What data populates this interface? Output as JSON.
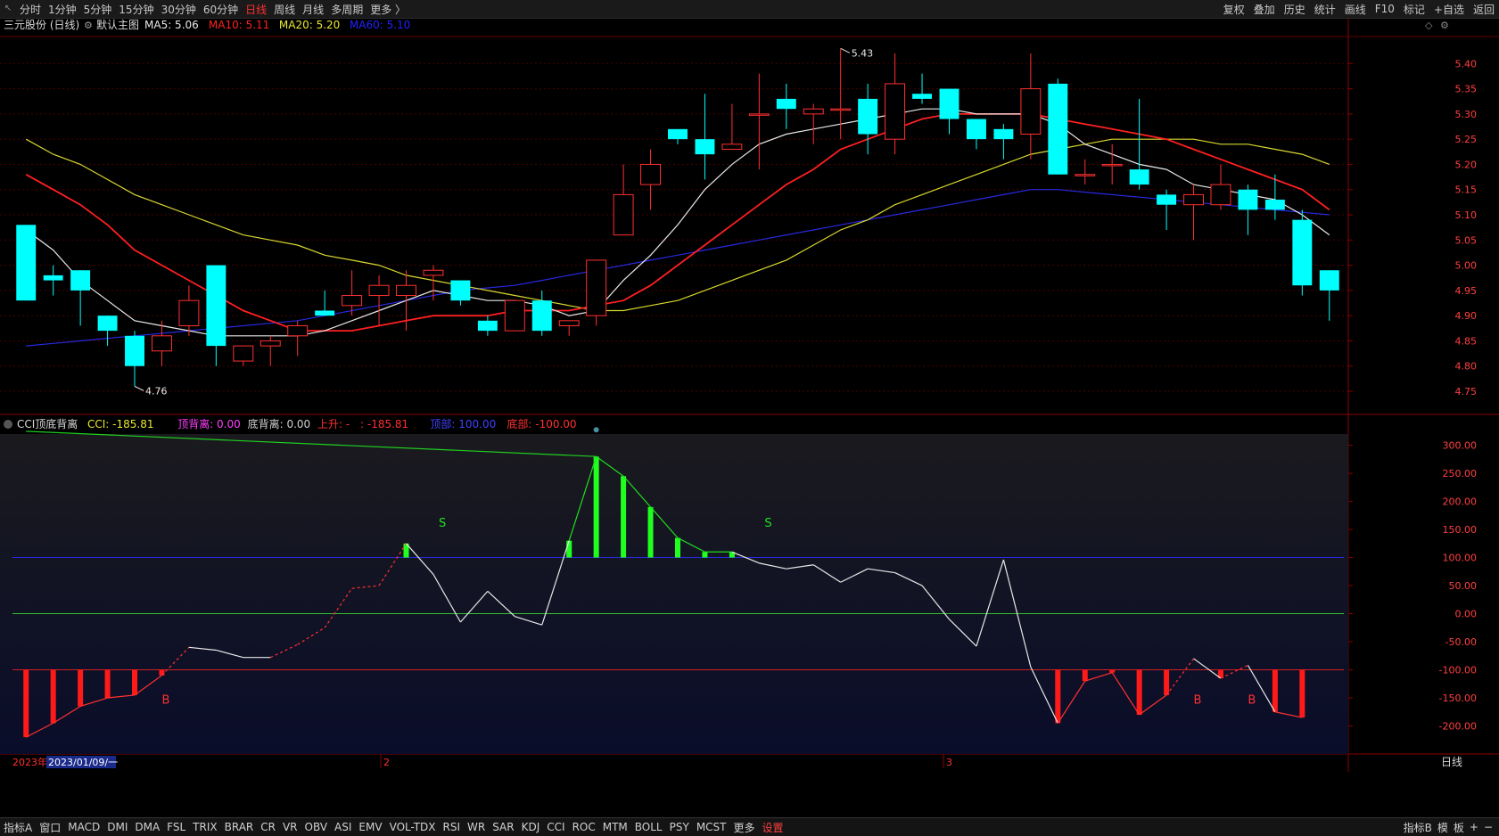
{
  "topbar": {
    "timeframes": [
      "分时",
      "1分钟",
      "5分钟",
      "15分钟",
      "30分钟",
      "60分钟",
      "日线",
      "周线",
      "月线",
      "多周期",
      "更多 〉"
    ],
    "active_timeframe": "日线",
    "tools": [
      "复权",
      "叠加",
      "历史",
      "统计",
      "画线",
      "F10",
      "标记",
      "+自选",
      "返回"
    ]
  },
  "price_panel": {
    "stock_title": "三元股份 (日线)",
    "main_chart_label": "默认主图",
    "ma_legend": [
      {
        "text": "MA5: 5.06",
        "color": "#e8e8e8"
      },
      {
        "text": "MA10: 5.11",
        "color": "#ff2020"
      },
      {
        "text": "MA20: 5.20",
        "color": "#e8e830"
      },
      {
        "text": "MA60: 5.10",
        "color": "#2020ff"
      }
    ],
    "high_label": "5.43",
    "low_label": "4.76",
    "colors": {
      "up": "#ff3030",
      "down": "#00ffff",
      "ma5": "#e8e8e8",
      "ma10": "#ff2020",
      "ma20": "#d8d830",
      "ma60": "#2828e0"
    }
  },
  "cci_panel": {
    "name": "CCI顶底背离",
    "legend": [
      {
        "text": "CCI: -185.81",
        "color": "#e8e830"
      },
      {
        "text": "顶背离: 0.00",
        "color": "#ff40ff"
      },
      {
        "text": "底背离: 0.00",
        "color": "#d0d0d0"
      },
      {
        "text": "上升: -",
        "color": "#ff3030"
      },
      {
        "text": ": -185.81",
        "color": "#ff3030"
      },
      {
        "text": "顶部: 100.00",
        "color": "#4040ff"
      },
      {
        "text": "底部: -100.00",
        "color": "#ff3030"
      }
    ],
    "signal_s": "S",
    "signal_b": "B"
  },
  "date_axis": {
    "year": "2023年",
    "cursor_date": "2023/01/09/一",
    "month_2": "2",
    "month_3": "3",
    "period_label": "日线"
  },
  "bottombar": {
    "indicators": [
      "指标A",
      "窗口",
      "MACD",
      "DMI",
      "DMA",
      "FSL",
      "TRIX",
      "BRAR",
      "CR",
      "VR",
      "OBV",
      "ASI",
      "EMV",
      "VOL-TDX",
      "RSI",
      "WR",
      "SAR",
      "KDJ",
      "CCI",
      "ROC",
      "MTM",
      "BOLL",
      "PSY",
      "MCST",
      "更多",
      "设置"
    ],
    "right": [
      "指标B",
      "模",
      "板",
      "+",
      "−"
    ]
  },
  "chart_data": [
    {
      "type": "candlestick",
      "title": "三元股份 (日线)",
      "ylim": [
        4.72,
        5.45
      ],
      "y_ticks": [
        4.75,
        4.8,
        4.85,
        4.9,
        4.95,
        5.0,
        5.05,
        5.1,
        5.15,
        5.2,
        5.25,
        5.3,
        5.35,
        5.4
      ],
      "ohlc": [
        [
          5.08,
          5.08,
          4.93,
          4.93
        ],
        [
          4.98,
          5.0,
          4.94,
          4.97
        ],
        [
          4.99,
          4.99,
          4.88,
          4.95
        ],
        [
          4.9,
          4.9,
          4.84,
          4.87
        ],
        [
          4.86,
          4.87,
          4.76,
          4.8
        ],
        [
          4.83,
          4.89,
          4.8,
          4.86
        ],
        [
          4.88,
          4.96,
          4.86,
          4.93
        ],
        [
          5.0,
          5.0,
          4.8,
          4.84
        ],
        [
          4.81,
          4.84,
          4.8,
          4.84
        ],
        [
          4.84,
          4.86,
          4.8,
          4.85
        ],
        [
          4.86,
          4.89,
          4.82,
          4.88
        ],
        [
          4.91,
          4.95,
          4.9,
          4.9
        ],
        [
          4.92,
          4.99,
          4.9,
          4.94
        ],
        [
          4.94,
          4.98,
          4.88,
          4.96
        ],
        [
          4.94,
          4.99,
          4.87,
          4.96
        ],
        [
          4.98,
          5.0,
          4.93,
          4.99
        ],
        [
          4.97,
          4.97,
          4.92,
          4.93
        ],
        [
          4.89,
          4.9,
          4.86,
          4.87
        ],
        [
          4.87,
          4.93,
          4.87,
          4.93
        ],
        [
          4.93,
          4.95,
          4.86,
          4.87
        ],
        [
          4.88,
          4.89,
          4.86,
          4.89
        ],
        [
          4.9,
          5.01,
          4.88,
          5.01
        ],
        [
          5.06,
          5.2,
          5.06,
          5.14
        ],
        [
          5.16,
          5.23,
          5.11,
          5.2
        ],
        [
          5.27,
          5.27,
          5.24,
          5.25
        ],
        [
          5.25,
          5.34,
          5.17,
          5.22
        ],
        [
          5.23,
          5.32,
          5.23,
          5.24
        ],
        [
          5.3,
          5.38,
          5.19,
          5.3
        ],
        [
          5.33,
          5.36,
          5.27,
          5.31
        ],
        [
          5.3,
          5.32,
          5.24,
          5.31
        ],
        [
          5.31,
          5.43,
          5.25,
          5.31
        ],
        [
          5.33,
          5.36,
          5.22,
          5.26
        ],
        [
          5.25,
          5.42,
          5.22,
          5.36
        ],
        [
          5.34,
          5.38,
          5.32,
          5.33
        ],
        [
          5.35,
          5.35,
          5.26,
          5.29
        ],
        [
          5.29,
          5.29,
          5.23,
          5.25
        ],
        [
          5.27,
          5.28,
          5.21,
          5.25
        ],
        [
          5.26,
          5.42,
          5.21,
          5.35
        ],
        [
          5.36,
          5.37,
          5.18,
          5.18
        ],
        [
          5.18,
          5.21,
          5.16,
          5.18
        ],
        [
          5.2,
          5.24,
          5.16,
          5.2
        ],
        [
          5.19,
          5.33,
          5.15,
          5.16
        ],
        [
          5.14,
          5.15,
          5.07,
          5.12
        ],
        [
          5.12,
          5.16,
          5.05,
          5.14
        ],
        [
          5.12,
          5.2,
          5.11,
          5.16
        ],
        [
          5.15,
          5.16,
          5.06,
          5.11
        ],
        [
          5.13,
          5.18,
          5.09,
          5.11
        ],
        [
          5.09,
          5.11,
          4.94,
          4.96
        ],
        [
          4.99,
          4.99,
          4.89,
          4.95
        ]
      ],
      "ma5": [
        5.07,
        5.03,
        4.97,
        4.93,
        4.89,
        4.88,
        4.87,
        4.86,
        4.86,
        4.86,
        4.86,
        4.87,
        4.89,
        4.91,
        4.93,
        4.95,
        4.94,
        4.93,
        4.93,
        4.92,
        4.9,
        4.91,
        4.97,
        5.02,
        5.08,
        5.15,
        5.2,
        5.24,
        5.26,
        5.27,
        5.28,
        5.29,
        5.3,
        5.31,
        5.31,
        5.3,
        5.3,
        5.3,
        5.28,
        5.24,
        5.22,
        5.2,
        5.19,
        5.16,
        5.15,
        5.14,
        5.13,
        5.1,
        5.06
      ],
      "ma10": [
        5.18,
        5.15,
        5.12,
        5.08,
        5.03,
        5.0,
        4.97,
        4.94,
        4.91,
        4.89,
        4.87,
        4.87,
        4.87,
        4.88,
        4.89,
        4.9,
        4.9,
        4.9,
        4.91,
        4.91,
        4.91,
        4.92,
        4.93,
        4.96,
        5.0,
        5.04,
        5.08,
        5.12,
        5.16,
        5.19,
        5.23,
        5.25,
        5.27,
        5.29,
        5.3,
        5.3,
        5.3,
        5.3,
        5.29,
        5.28,
        5.27,
        5.26,
        5.25,
        5.23,
        5.21,
        5.19,
        5.17,
        5.15,
        5.11
      ],
      "ma20": [
        5.25,
        5.22,
        5.2,
        5.17,
        5.14,
        5.12,
        5.1,
        5.08,
        5.06,
        5.05,
        5.04,
        5.02,
        5.01,
        5.0,
        4.98,
        4.97,
        4.96,
        4.95,
        4.94,
        4.93,
        4.92,
        4.91,
        4.91,
        4.92,
        4.93,
        4.95,
        4.97,
        4.99,
        5.01,
        5.04,
        5.07,
        5.09,
        5.12,
        5.14,
        5.16,
        5.18,
        5.2,
        5.22,
        5.23,
        5.24,
        5.25,
        5.25,
        5.25,
        5.25,
        5.24,
        5.24,
        5.23,
        5.22,
        5.2
      ],
      "ma60": [
        4.84,
        4.845,
        4.85,
        4.855,
        4.86,
        4.865,
        4.87,
        4.875,
        4.88,
        4.885,
        4.89,
        4.9,
        4.91,
        4.92,
        4.93,
        4.94,
        4.95,
        4.955,
        4.96,
        4.97,
        4.98,
        4.99,
        5.0,
        5.01,
        5.02,
        5.03,
        5.04,
        5.05,
        5.06,
        5.07,
        5.08,
        5.09,
        5.1,
        5.11,
        5.12,
        5.13,
        5.14,
        5.15,
        5.15,
        5.145,
        5.14,
        5.135,
        5.13,
        5.125,
        5.12,
        5.115,
        5.11,
        5.105,
        5.1
      ]
    },
    {
      "type": "line",
      "title": "CCI顶底背离",
      "ylim": [
        -250,
        320
      ],
      "y_ticks": [
        300,
        250,
        200,
        150,
        100,
        50,
        0,
        -50,
        -100,
        -150,
        -200
      ],
      "reference_lines": {
        "top": 100,
        "zero": 0,
        "bottom": -100
      },
      "cci": [
        -220,
        -195,
        -165,
        -150,
        -145,
        -110,
        -60,
        -65,
        -78,
        -78,
        -55,
        -25,
        45,
        50,
        125,
        70,
        -15,
        40,
        -5,
        -20,
        130,
        280,
        245,
        190,
        135,
        110,
        110,
        90,
        80,
        87,
        56,
        80,
        73,
        50,
        -10,
        -58,
        96,
        -95,
        -195,
        -120,
        -105,
        -180,
        -145,
        -80,
        -115,
        -92,
        -175,
        -185
      ],
      "divergence_line": {
        "from_bar": 0,
        "to_bar": 21,
        "from_value": 325,
        "to_value": 280
      }
    }
  ]
}
